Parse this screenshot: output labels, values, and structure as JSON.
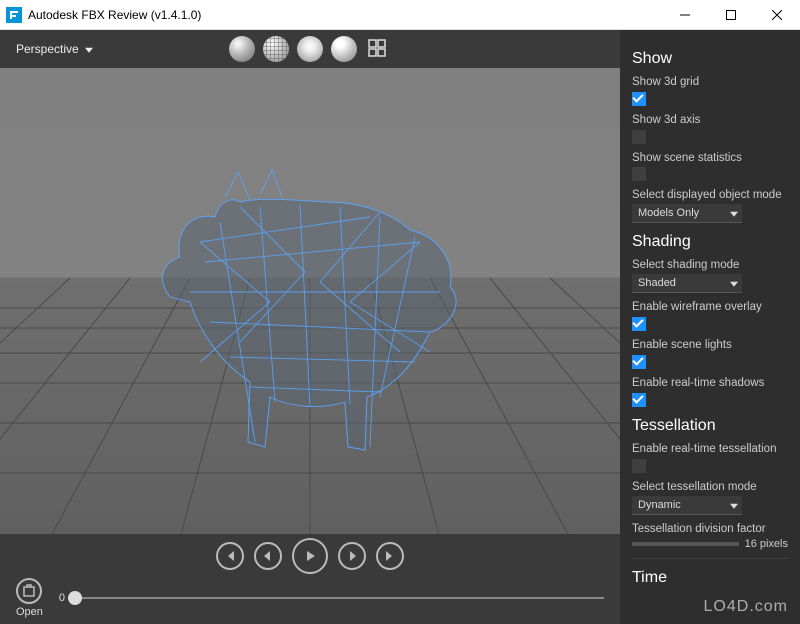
{
  "window": {
    "title": "Autodesk FBX Review (v1.4.1.0)"
  },
  "toolbar": {
    "view_mode": "Perspective",
    "icons": [
      "shaded",
      "wireframe",
      "light",
      "contrast",
      "multiview"
    ]
  },
  "transport": {
    "open_label": "Open",
    "timeline_start": "0"
  },
  "panel": {
    "show": {
      "title": "Show",
      "grid": {
        "label": "Show 3d grid",
        "checked": true
      },
      "axis": {
        "label": "Show 3d axis",
        "checked": false
      },
      "stats": {
        "label": "Show scene statistics",
        "checked": false
      },
      "obj_mode_label": "Select displayed object mode",
      "obj_mode_value": "Models Only"
    },
    "shading": {
      "title": "Shading",
      "mode_label": "Select shading mode",
      "mode_value": "Shaded",
      "wire": {
        "label": "Enable wireframe overlay",
        "checked": true
      },
      "lights": {
        "label": "Enable scene lights",
        "checked": true
      },
      "shadows": {
        "label": "Enable real-time shadows",
        "checked": true
      }
    },
    "tess": {
      "title": "Tessellation",
      "rt": {
        "label": "Enable real-time tessellation",
        "checked": false
      },
      "mode_label": "Select tessellation mode",
      "mode_value": "Dynamic",
      "factor_label": "Tessellation division factor",
      "factor_value": "16 pixels"
    },
    "time": {
      "title": "Time"
    }
  },
  "watermark": "LO4D.com"
}
